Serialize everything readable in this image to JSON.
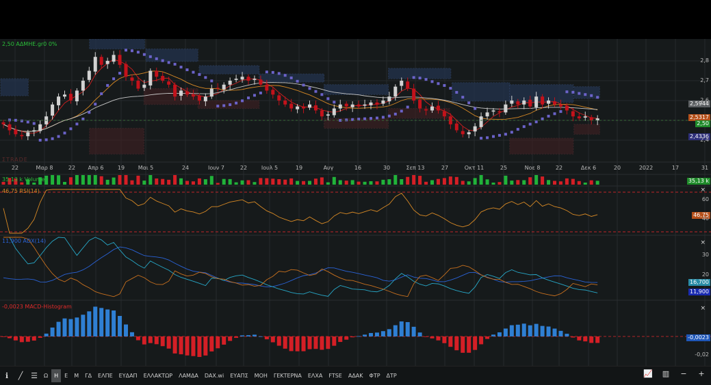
{
  "symbol_label": "2,50 ΑΔΜΗΕ.gr0 0%",
  "watermark": "ΣTRADE",
  "price_axis": {
    "ticks": [
      "2,8",
      "2,7",
      "2,6",
      "2,4"
    ],
    "tick_values": [
      2.8,
      2.7,
      2.6,
      2.4
    ]
  },
  "price_tags": [
    {
      "text": "2,5944",
      "color": "#5d6063"
    },
    {
      "text": "2,5317",
      "color": "#b5501a"
    },
    {
      "text": "2,50",
      "color": "#1f8a2a"
    },
    {
      "text": "2,4336",
      "color": "#2e2f7a"
    }
  ],
  "x_axis": {
    "ticks": [
      "22",
      "Μαρ 8",
      "22",
      "Απρ 6",
      "19",
      "Μαι 5",
      "24",
      "Ιουν 7",
      "22",
      "Ιουλ 5",
      "19",
      "Αυγ",
      "16",
      "30",
      "Σεπ 13",
      "27",
      "Οκτ 11",
      "25",
      "Νοε 8",
      "22",
      "Δεκ 6",
      "20",
      "2022",
      "17",
      "31"
    ]
  },
  "volume": {
    "label": "35,13 k Volume",
    "tag": "35,13 k",
    "close": "×"
  },
  "rsi": {
    "label": "46,75 RSI(14)",
    "tag": "46,75",
    "ticks": [
      "60",
      "40"
    ],
    "close": "×"
  },
  "adx": {
    "label": "11,900 ADX(14)",
    "tags": [
      "16,700",
      "11,900"
    ],
    "ticks": [
      "30",
      "20"
    ],
    "close": "×"
  },
  "macd": {
    "label": "-0,0023 MACD-Histogram",
    "tag": "-0,0023",
    "ticks": [
      "-0,02"
    ],
    "close": "×"
  },
  "colors": {
    "up": "#d2d2d2",
    "down": "#c3121b",
    "sar": "#6b63c9",
    "ma_fast": "#d2201f",
    "ma_mid": "#d98a25",
    "ma_slow": "#c8c8c8",
    "adx": "#2a63d8",
    "pdi": "#27a8c8",
    "mdi": "#c8701e",
    "macd_pos": "#2f7fd3",
    "macd_neg": "#d41f26"
  },
  "toolbar": {
    "items": [
      "Ω",
      "Η",
      "Ε",
      "Μ",
      "ΓΔ",
      "ΕΛΠΕ",
      "ΕΥΔΑΠ",
      "ΕΛΛΑΚΤΩΡ",
      "ΛΑΜΔΑ",
      "DAX.wi",
      "ΕΥΑΠΣ",
      "ΜΟΗ",
      "ΓΕΚΤΕΡΝΑ",
      "ΕΛΧΑ",
      "FTSE",
      "ΑΔΑΚ",
      "ΦΤΡ",
      "ΔΤΡ"
    ],
    "active": "Η"
  },
  "chart_data": {
    "type": "candlestick",
    "title": "ΑΔΜΗΕ.gr",
    "ylim": [
      2.3,
      2.91
    ],
    "closes": [
      2.48,
      2.45,
      2.43,
      2.42,
      2.44,
      2.45,
      2.48,
      2.52,
      2.58,
      2.62,
      2.63,
      2.6,
      2.65,
      2.7,
      2.75,
      2.82,
      2.78,
      2.8,
      2.83,
      2.78,
      2.72,
      2.7,
      2.66,
      2.68,
      2.75,
      2.72,
      2.7,
      2.68,
      2.62,
      2.65,
      2.63,
      2.62,
      2.6,
      2.62,
      2.66,
      2.66,
      2.68,
      2.7,
      2.71,
      2.72,
      2.7,
      2.71,
      2.68,
      2.65,
      2.63,
      2.6,
      2.58,
      2.56,
      2.57,
      2.56,
      2.58,
      2.55,
      2.52,
      2.53,
      2.56,
      2.58,
      2.57,
      2.58,
      2.57,
      2.58,
      2.59,
      2.58,
      2.6,
      2.62,
      2.67,
      2.7,
      2.66,
      2.6,
      2.56,
      2.55,
      2.57,
      2.55,
      2.52,
      2.48,
      2.45,
      2.43,
      2.44,
      2.47,
      2.52,
      2.54,
      2.55,
      2.54,
      2.58,
      2.6,
      2.58,
      2.6,
      2.57,
      2.62,
      2.58,
      2.6,
      2.58,
      2.57,
      2.55,
      2.52,
      2.51,
      2.52,
      2.5,
      2.51
    ],
    "zones_supply": [
      [
        0,
        4.5,
        2.71,
        2.624
      ],
      [
        14.5,
        23.5,
        2.91,
        2.86
      ],
      [
        23.7,
        32.2,
        2.86,
        2.797
      ],
      [
        32.4,
        42.2,
        2.776,
        2.734
      ],
      [
        42.2,
        52.8,
        2.734,
        2.693
      ],
      [
        52.8,
        63.3,
        2.68,
        2.63
      ],
      [
        63.3,
        73.5,
        2.762,
        2.71
      ],
      [
        73.7,
        83.1,
        2.69,
        2.597
      ],
      [
        83.1,
        93.5,
        2.68,
        2.59
      ],
      [
        93.6,
        97.8,
        2.67,
        2.61
      ]
    ],
    "zones_demand": [
      [
        14.5,
        23.4,
        2.46,
        2.33
      ],
      [
        23.4,
        32.2,
        2.66,
        2.58
      ],
      [
        32.2,
        42.2,
        2.6,
        2.56
      ],
      [
        52.8,
        63.3,
        2.51,
        2.46
      ],
      [
        63.3,
        73.3,
        2.56,
        2.51
      ],
      [
        83.1,
        93.5,
        2.41,
        2.33
      ],
      [
        93.6,
        97.8,
        2.48,
        2.43
      ]
    ]
  }
}
